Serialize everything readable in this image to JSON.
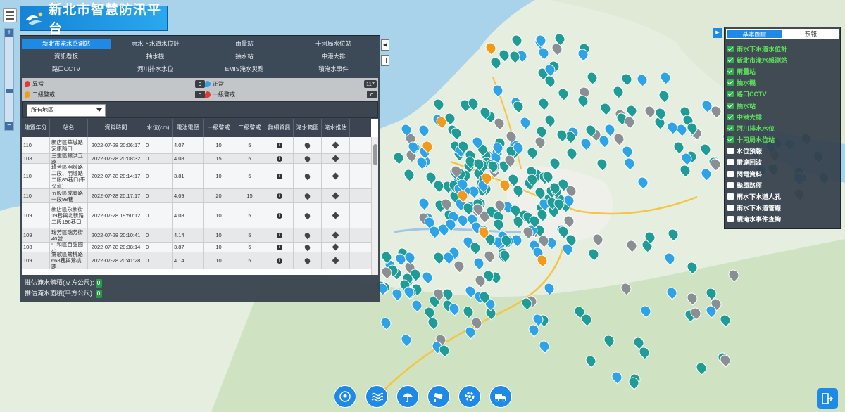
{
  "header": {
    "title": "新北市智慧防汛平台"
  },
  "tabs": [
    {
      "label": "新北市淹水感測站",
      "active": true
    },
    {
      "label": "雨水下水道水位計",
      "active": false
    },
    {
      "label": "雨量站",
      "active": false
    },
    {
      "label": "十河局水位站",
      "active": false
    },
    {
      "label": "資訊看板",
      "active": false
    },
    {
      "label": "抽水機",
      "active": false
    },
    {
      "label": "抽水站",
      "active": false
    },
    {
      "label": "中港大排",
      "active": false
    },
    {
      "label": "路口CCTV",
      "active": false
    },
    {
      "label": "河川排水水位",
      "active": false
    },
    {
      "label": "EMIS淹水災點",
      "active": false
    },
    {
      "label": "積淹水事件",
      "active": false
    }
  ],
  "legend": {
    "abnormal": {
      "label": "異常",
      "count": "0",
      "color": "#e53935"
    },
    "normal": {
      "label": "正常",
      "count": "117",
      "color": "#2ea4e6"
    },
    "level2": {
      "label": "二級警戒",
      "count": "0",
      "color": "#f39a1a"
    },
    "level1": {
      "label": "一級警戒",
      "count": "0",
      "color": "#e53935"
    }
  },
  "filter": {
    "area_selected": "所有地區"
  },
  "table": {
    "columns": [
      "建置年分",
      "站名",
      "資料時間",
      "水位(cm)",
      "電池電壓",
      "一級警戒",
      "二級警戒",
      "詳細資訊",
      "淹水範圍",
      "淹水推估"
    ],
    "rows": [
      {
        "year": "110",
        "name": "新店區華城路安康路口",
        "time": "2022-07-28 20:06:17",
        "level": "0",
        "voltage": "4.07",
        "warn1": "10",
        "warn2": "5"
      },
      {
        "year": "108",
        "name": "三重區銀洪五路",
        "time": "2022-07-28 20:08:32",
        "level": "0",
        "voltage": "4.08",
        "warn1": "15",
        "warn2": "5"
      },
      {
        "year": "110",
        "name": "瑞芳區明燈路二段、明燈路二段85巷口(平交道)",
        "time": "2022-07-28 20:14:17",
        "level": "0",
        "voltage": "3.81",
        "warn1": "10",
        "warn2": "5"
      },
      {
        "year": "110",
        "name": "五股區成泰路一段98巷",
        "time": "2022-07-28 20:17:17",
        "level": "0",
        "voltage": "4.09",
        "warn1": "20",
        "warn2": "15"
      },
      {
        "year": "109",
        "name": "新店區永新街19巷與北新路二段196巷口",
        "time": "2022-07-28 19:50:12",
        "level": "0",
        "voltage": "4.08",
        "warn1": "10",
        "warn2": "5"
      },
      {
        "year": "109",
        "name": "瑞芳區瑞芳街40號",
        "time": "2022-07-28 20:10:41",
        "level": "0",
        "voltage": "4.14",
        "warn1": "10",
        "warn2": "5"
      },
      {
        "year": "108",
        "name": "中和區自強國小",
        "time": "2022-07-28 20:38:14",
        "level": "0",
        "voltage": "3.87",
        "warn1": "10",
        "warn2": "5"
      },
      {
        "year": "109",
        "name": "鶯歌區鶯桃路668巷與鶯桃路",
        "time": "2022-07-28 20:41:28",
        "level": "0",
        "voltage": "4.14",
        "warn1": "10",
        "warn2": "5"
      }
    ],
    "info_glyph": "i"
  },
  "summary": {
    "volume_label": "推估淹水體積(立方公尺):",
    "volume_value": "0",
    "area_label": "推估淹水面積(平方公尺):",
    "area_value": "0"
  },
  "right_panel": {
    "tabs": [
      {
        "label": "基本圖層",
        "active": true
      },
      {
        "label": "預報",
        "active": false
      }
    ],
    "layers": [
      {
        "label": "雨水下水道水位計",
        "checked": true
      },
      {
        "label": "新北市淹水感測站",
        "checked": true
      },
      {
        "label": "雨量站",
        "checked": true
      },
      {
        "label": "抽水機",
        "checked": true
      },
      {
        "label": "路口CCTV",
        "checked": true
      },
      {
        "label": "抽水站",
        "checked": true
      },
      {
        "label": "中港大排",
        "checked": true
      },
      {
        "label": "河川排水水位",
        "checked": true
      },
      {
        "label": "十河局水位站",
        "checked": true
      },
      {
        "label": "水位預報",
        "checked": false
      },
      {
        "label": "雷達回波",
        "checked": false
      },
      {
        "label": "閃電資料",
        "checked": false
      },
      {
        "label": "颱風路徑",
        "checked": false
      },
      {
        "label": "雨水下水道人孔",
        "checked": false
      },
      {
        "label": "雨水下水道管線",
        "checked": false
      },
      {
        "label": "積淹水事件查詢",
        "checked": false
      }
    ]
  },
  "toolbar": {
    "icons": [
      "globe-pin-icon",
      "waves-icon",
      "umbrella-icon",
      "cctv-icon",
      "gear-icon",
      "truck-icon"
    ]
  },
  "colors": {
    "accent": "#1e8ae6",
    "panel": "#343e4a",
    "checked": "#2db34a",
    "marker_teal": "#1f9c96"
  }
}
